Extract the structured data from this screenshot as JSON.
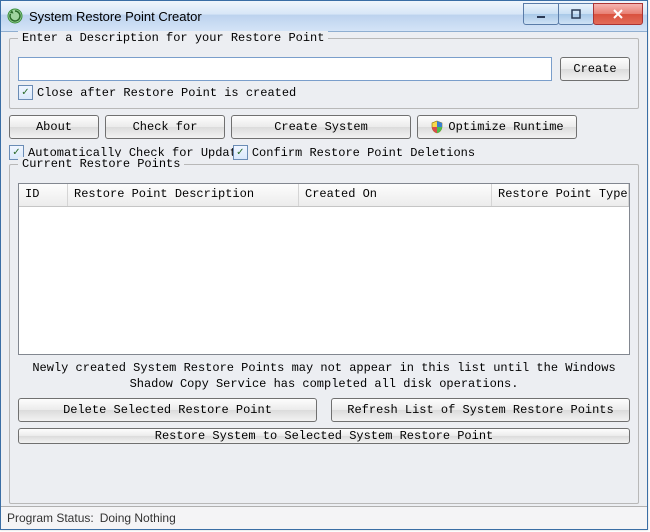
{
  "window": {
    "title": "System Restore Point Creator"
  },
  "group_description": {
    "title": "Enter a Description for your Restore Point",
    "input_value": "",
    "create_button": "Create",
    "close_after_label": "Close after Restore Point is created",
    "close_after_checked": "✓"
  },
  "toolbar": {
    "about": "About",
    "check_for": "Check for",
    "create_system": "Create System",
    "optimize_runtime": "Optimize Runtime"
  },
  "options": {
    "auto_check_label": "Automatically Check for Updat",
    "auto_check_checked": "✓",
    "confirm_delete_label": "Confirm Restore Point Deletions",
    "confirm_delete_checked": "✓"
  },
  "restore_points": {
    "title": "Current Restore Points",
    "columns": {
      "id": "ID",
      "description": "Restore Point Description",
      "created_on": "Created On",
      "type": "Restore Point Type"
    },
    "rows": [],
    "helper_text": "Newly created System Restore Points may not appear in this list until the Windows\nShadow Copy Service has completed all disk operations."
  },
  "actions": {
    "delete_selected": "Delete Selected Restore Point",
    "refresh_list": "Refresh List of System Restore Points",
    "restore_selected": "Restore System to Selected System Restore Point"
  },
  "status": {
    "label": "Program Status:",
    "value": "Doing Nothing"
  }
}
